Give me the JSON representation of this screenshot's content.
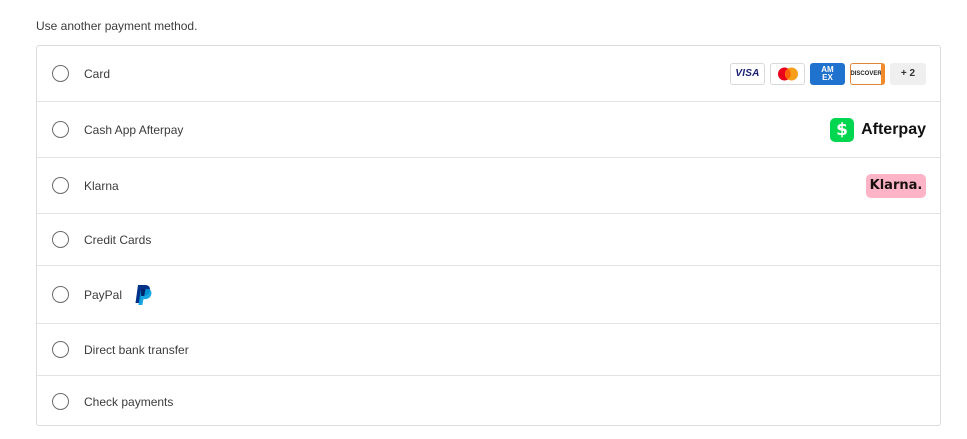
{
  "intro_text": "Use another payment method.",
  "methods": [
    {
      "label": "Card"
    },
    {
      "label": "Cash App Afterpay"
    },
    {
      "label": "Klarna"
    },
    {
      "label": "Credit Cards"
    },
    {
      "label": "PayPal"
    },
    {
      "label": "Direct bank transfer"
    },
    {
      "label": "Check payments"
    }
  ],
  "card_brands": {
    "visa": "VISA",
    "amex_line1": "AM",
    "amex_line2": "EX",
    "discover": "DISCOVER",
    "more": "+ 2"
  },
  "afterpay": {
    "icon": "$",
    "text": "Afterpay"
  },
  "klarna": {
    "text": "Klarna."
  },
  "colors": {
    "cashapp_green": "#00d64f",
    "klarna_pink": "#ffb3c7",
    "amex_blue": "#1f72cd",
    "paypal_dark": "#003087",
    "paypal_light": "#009cde"
  }
}
